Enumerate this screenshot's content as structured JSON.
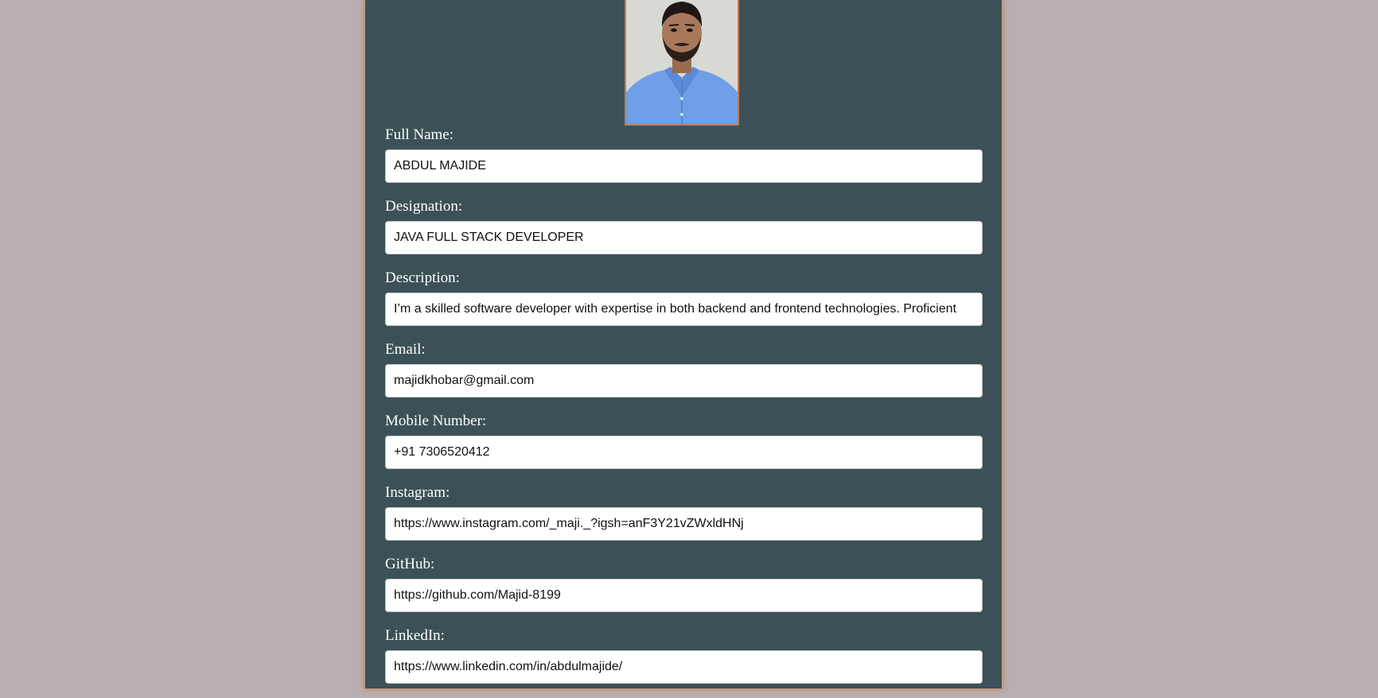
{
  "profile": {
    "photo_icon": "person-portrait-photo"
  },
  "fields": [
    {
      "label": "Full Name:",
      "value": "ABDUL MAJIDE"
    },
    {
      "label": "Designation:",
      "value": "JAVA FULL STACK DEVELOPER"
    },
    {
      "label": "Description:",
      "value": "I’m a skilled software developer with expertise in both backend and frontend technologies. Proficient"
    },
    {
      "label": "Email:",
      "value": "majidkhobar@gmail.com"
    },
    {
      "label": "Mobile Number:",
      "value": "+91 7306520412"
    },
    {
      "label": "Instagram:",
      "value": "https://www.instagram.com/_maji._?igsh=anF3Y21vZWxldHNj"
    },
    {
      "label": "GitHub:",
      "value": "https://github.com/Majid-8199"
    },
    {
      "label": "LinkedIn:",
      "value": "https://www.linkedin.com/in/abdulmajide/"
    }
  ],
  "colors": {
    "page_background": "#b9aeb1",
    "panel_background": "#3c5157",
    "panel_glow": "#c08a6e",
    "photo_border": "#c47a4e"
  }
}
